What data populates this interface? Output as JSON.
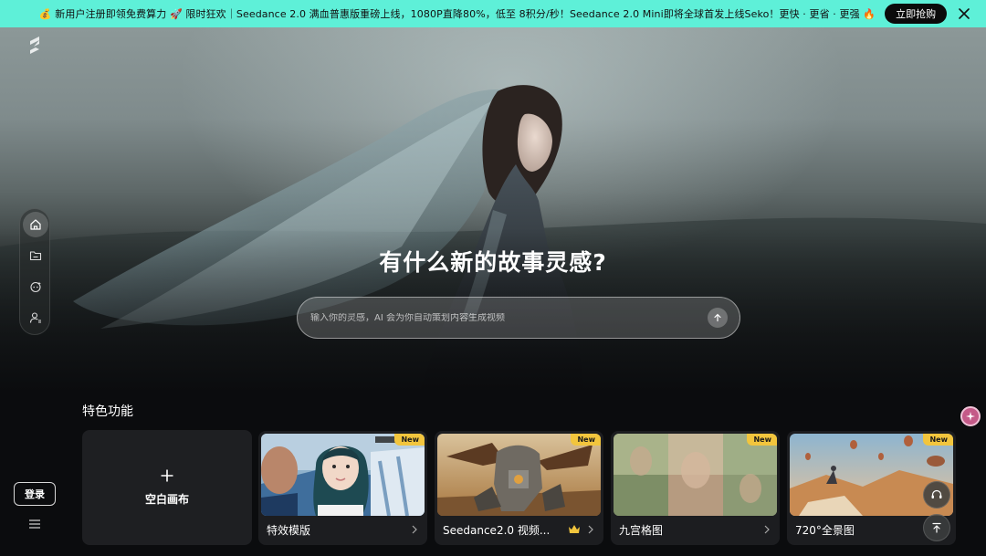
{
  "banner": {
    "text": "💰 新用户注册即领免费算力 🚀 限时狂欢｜Seedance 2.0 满血普惠版重磅上线，1080P直降80%，低至 8积分/秒！Seedance 2.0 Mini即将全球首发上线Seko！更快 · 更省 · 更强 🔥",
    "cta_label": "立即抢购"
  },
  "hero": {
    "headline": "有什么新的故事灵感?",
    "prompt_placeholder": "输入你的灵感，AI 会为你自动策划内容生成视频"
  },
  "sidebar": {
    "items": [
      {
        "name": "home",
        "active": true
      },
      {
        "name": "projects",
        "active": false
      },
      {
        "name": "ai-assistant",
        "active": false
      },
      {
        "name": "account",
        "active": false
      }
    ],
    "login_label": "登录"
  },
  "features": {
    "section_title": "特色功能",
    "blank_label": "空白画布",
    "cards": [
      {
        "label": "特效模版",
        "badge": "New"
      },
      {
        "label": "Seedance2.0 视频...",
        "badge": "New"
      },
      {
        "label": "九宫格图",
        "badge": "New"
      },
      {
        "label": "720°全景图",
        "badge": "New"
      }
    ]
  },
  "colors": {
    "banner_bg": "#5ef0d8",
    "badge": "#f2c53d",
    "page_bg": "#0b0c0e"
  }
}
